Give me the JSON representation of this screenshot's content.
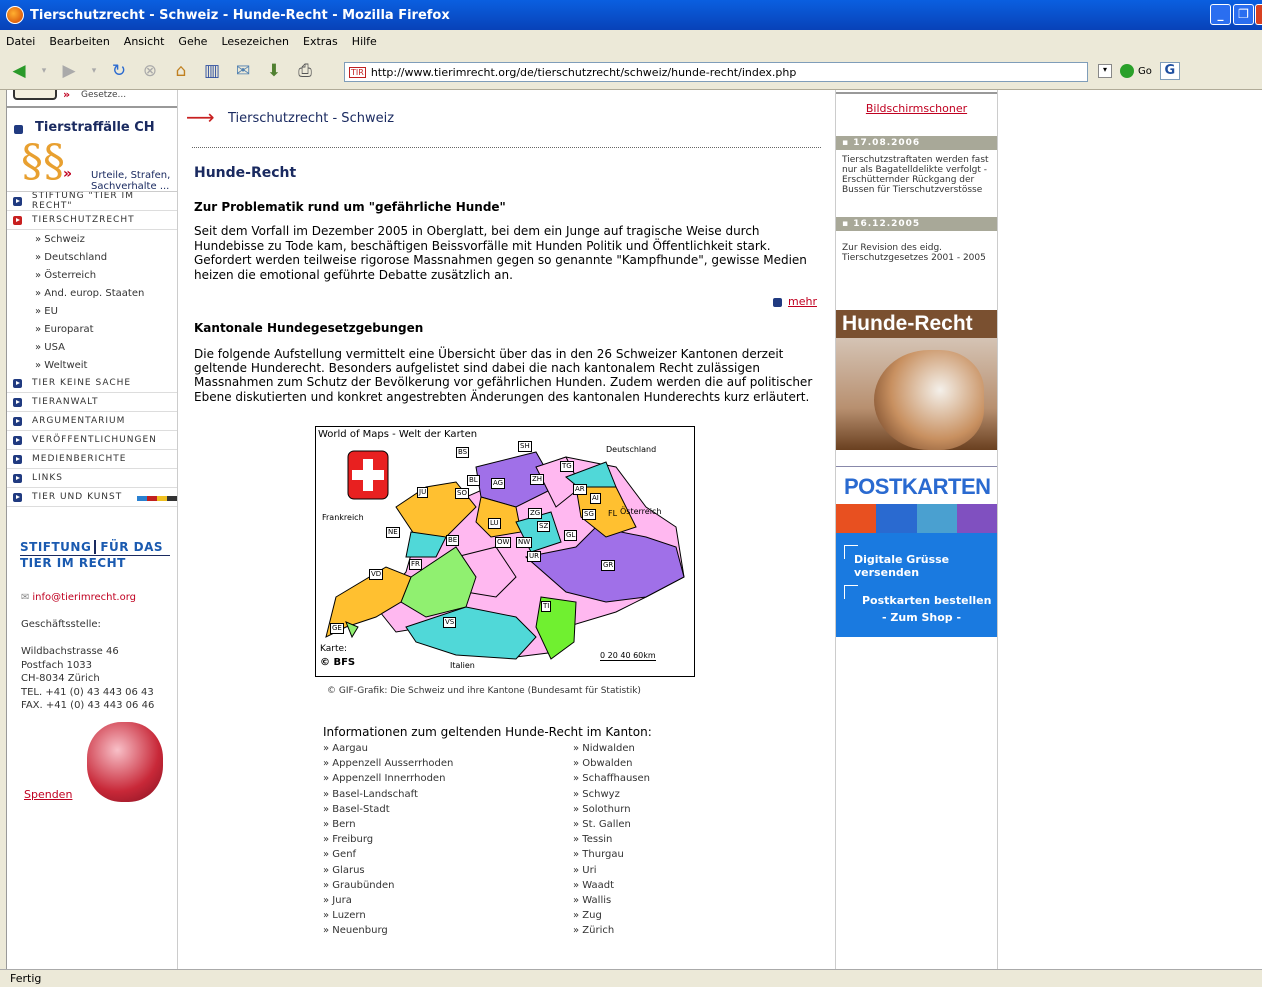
{
  "window": {
    "title": "Tierschutzrecht - Schweiz - Hunde-Recht - Mozilla Firefox"
  },
  "menu": [
    "Datei",
    "Bearbeiten",
    "Ansicht",
    "Gehe",
    "Lesezeichen",
    "Extras",
    "Hilfe"
  ],
  "url": "http://www.tierimrecht.org/de/tierschutzrecht/schweiz/hunde-recht/index.php",
  "url_favicon": "TIR",
  "go_label": "Go",
  "status": "Fertig",
  "left": {
    "top_banner": "Gesetze...",
    "straffaelle_title": "Tierstraffälle CH",
    "straffaelle_sub": [
      "Urteile, Strafen,",
      "Sachverhalte ..."
    ],
    "nav_top": [
      {
        "label": "STIFTUNG \"TIER IM RECHT\"",
        "active": false
      },
      {
        "label": "TIERSCHUTZRECHT",
        "active": true
      }
    ],
    "sub_items": [
      "» Schweiz",
      "» Deutschland",
      "» Österreich",
      "» And. europ. Staaten",
      "» EU",
      "» Europarat",
      "» USA",
      "» Weltweit"
    ],
    "nav_bottom": [
      "TIER KEINE SACHE",
      "TIERANWALT",
      "ARGUMENTARIUM",
      "VERÖFFENTLICHUNGEN",
      "MEDIENBERICHTE",
      "LINKS",
      "TIER UND KUNST"
    ],
    "logo_line1_a": "STIFTUNG",
    "logo_line1_b": "FÜR DAS",
    "logo_line2": "TIER IM RECHT",
    "email": "info@tierimrecht.org",
    "office_label": "Geschäftsstelle:",
    "address": [
      "Wildbachstrasse 46",
      "Postfach 1033",
      "CH-8034 Zürich",
      "TEL. +41 (0) 43 443 06 43",
      "FAX. +41 (0) 43 443 06 46"
    ],
    "spenden": "Spenden"
  },
  "center": {
    "section_title": "Tierschutzrecht - Schweiz",
    "page_title": "Hunde-Recht",
    "h2_1": "Zur Problematik rund um \"gefährliche Hunde\"",
    "p1": "Seit dem Vorfall im Dezember 2005 in Oberglatt, bei dem ein Junge auf tragische Weise durch Hundebisse zu Tode kam, beschäftigen Beissvorfälle mit Hunden Politik und Öffentlichkeit stark. Gefordert werden teilweise rigorose Massnahmen gegen so genannte \"Kampfhunde\", gewisse Medien heizen die emotional geführte Debatte zusätzlich an.",
    "mehr": "mehr",
    "h2_2": "Kantonale Hundegesetzgebungen",
    "p2": "Die folgende Aufstellung vermittelt eine Übersicht über das in den 26 Schweizer Kantonen derzeit geltende Hunderecht. Besonders aufgelistet sind dabei die nach kantonalem Recht zulässigen Massnahmen zum Schutz der Bevölkerung vor gefährlichen Hunden. Zudem werden die auf politischer Ebene diskutierten und konkret angestrebten Änderungen des kantonalen Hunderechts kurz erläutert.",
    "map": {
      "header": "World of Maps - Welt der Karten",
      "de": "Deutschland",
      "fr": "Frankreich",
      "at": "Österreich",
      "fl": "FL",
      "it": "Italien",
      "karte": "Karte:",
      "bfs": "© BFS",
      "scale": "0  20  40  60km",
      "cantons": [
        "BS",
        "SH",
        "TG",
        "BL",
        "AG",
        "ZH",
        "JU",
        "SO",
        "AR",
        "AI",
        "SG",
        "LU",
        "ZG",
        "SZ",
        "NE",
        "BE",
        "OW",
        "NW",
        "GL",
        "UR",
        "FR",
        "GR",
        "VD",
        "TI",
        "VS",
        "GE"
      ]
    },
    "caption": "© GIF-Grafik: Die Schweiz und ihre Kantone (Bundesamt für Statistik)",
    "cantons_title": "Informationen zum geltenden Hunde-Recht im Kanton:",
    "cantons_col1": [
      "» Aargau",
      "» Appenzell Ausserrhoden",
      "» Appenzell Innerrhoden",
      "» Basel-Landschaft",
      "» Basel-Stadt",
      "» Bern",
      "» Freiburg",
      "» Genf",
      "» Glarus",
      "» Graubünden",
      "» Jura",
      "» Luzern",
      "» Neuenburg"
    ],
    "cantons_col2": [
      "» Nidwalden",
      "» Obwalden",
      "» Schaffhausen",
      "» Schwyz",
      "» Solothurn",
      "» St. Gallen",
      "» Tessin",
      "» Thurgau",
      "» Uri",
      "» Waadt",
      "» Wallis",
      "» Zug",
      "» Zürich"
    ]
  },
  "right": {
    "screensaver": "Bildschirmschoner",
    "news": [
      {
        "date": "17.08.2006",
        "text": "Tierschutzstraftaten werden fast nur als Bagatelldelikte verfolgt - Erschütternder Rückgang der Bussen für Tierschutzverstösse"
      },
      {
        "date": "16.12.2005",
        "text": "Zur Revision des eidg. Tierschutzgesetzes 2001 - 2005"
      }
    ],
    "promo_title": "Hunde-Recht",
    "postkarten": "POSTKARTEN",
    "digital": "Digitale Grüsse versenden",
    "bestellen": "Postkarten bestellen",
    "shop": "- Zum Shop -"
  }
}
